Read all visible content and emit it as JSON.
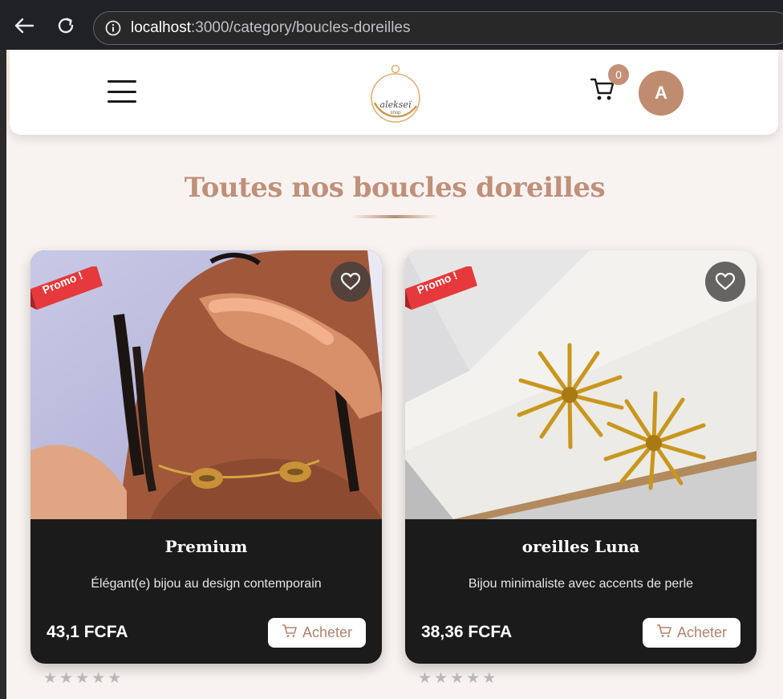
{
  "browser": {
    "url_host": "localhost",
    "url_path": ":3000/category/boucles-doreilles"
  },
  "header": {
    "logo_text": "alekseï",
    "logo_sub": "shop",
    "cart_count": "0",
    "avatar_initial": "A"
  },
  "page": {
    "title": "Toutes nos boucles doreilles"
  },
  "products": [
    {
      "badge": "Promo !",
      "name": "Premium",
      "description": "Élégant(e) bijou au design contemporain",
      "price": "43,1 FCFA",
      "buy_label": "Acheter",
      "rating": 0,
      "rating_max": 5
    },
    {
      "badge": "Promo !",
      "name": "oreilles Luna",
      "description": "Bijou minimaliste avec accents de perle",
      "price": "38,36 FCFA",
      "buy_label": "Acheter",
      "rating": 0,
      "rating_max": 5
    }
  ],
  "colors": {
    "accent": "#bf8c70",
    "title": "#bf907a",
    "card_bg": "#1b1b1c",
    "promo": "#e5393b",
    "page_bg": "#f8f3f0"
  },
  "icons": {
    "back": "arrow-left-icon",
    "reload": "reload-icon",
    "info": "info-icon",
    "menu": "hamburger-icon",
    "cart": "cart-icon",
    "wishlist": "heart-icon",
    "buy": "cart-icon",
    "star": "star-icon"
  }
}
